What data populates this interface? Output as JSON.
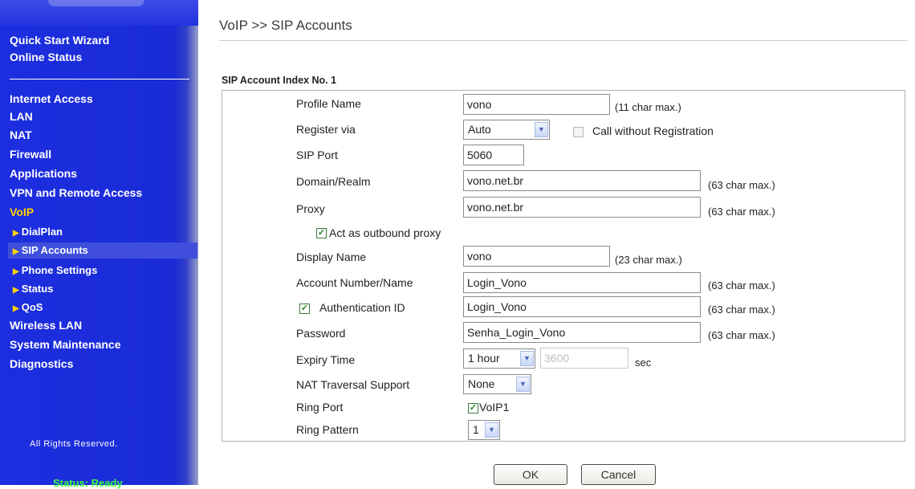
{
  "sidebar": {
    "top_items": [
      "Quick Start Wizard",
      "Online Status"
    ],
    "items": [
      "Internet Access",
      "LAN",
      "NAT",
      "Firewall",
      "Applications",
      "VPN and Remote Access",
      "VoIP"
    ],
    "voip_sub": [
      "DialPlan",
      "SIP Accounts",
      "Phone Settings",
      "Status",
      "QoS"
    ],
    "bottom_items": [
      "Wireless LAN",
      "System Maintenance",
      "Diagnostics"
    ],
    "rights": "All Rights Reserved.",
    "status": "Status: Ready",
    "selected_sub": "SIP Accounts",
    "active_section": "VoIP",
    "accent_color": "#ffd200"
  },
  "main": {
    "title": "VoIP >> SIP Accounts",
    "section_title": "SIP Account Index No. 1",
    "form": {
      "profile_name": {
        "label": "Profile Name",
        "value": "vono",
        "hint": "(11 char max.)"
      },
      "register_via": {
        "label": "Register via",
        "value": "Auto",
        "checkbox_label": "Call without Registration",
        "checkbox_checked": false
      },
      "sip_port": {
        "label": "SIP Port",
        "value": "5060"
      },
      "domain": {
        "label": "Domain/Realm",
        "value": "vono.net.br",
        "hint": "(63 char max.)"
      },
      "proxy": {
        "label": "Proxy",
        "value": "vono.net.br",
        "hint": "(63 char max.)"
      },
      "outbound_proxy": {
        "label": "Act as outbound proxy",
        "checked": true
      },
      "display_name": {
        "label": "Display Name",
        "value": "vono",
        "hint": "(23 char max.)"
      },
      "account_number": {
        "label": "Account Number/Name",
        "value": "Login_Vono",
        "hint": "(63 char max.)"
      },
      "auth_id": {
        "label": "Authentication ID",
        "value": "Login_Vono",
        "hint": "(63 char max.)",
        "checked": true
      },
      "password": {
        "label": "Password",
        "value": "Senha_Login_Vono",
        "hint": "(63 char max.)"
      },
      "expiry": {
        "label": "Expiry Time",
        "value": "1 hour",
        "seconds": "3600",
        "unit": "sec"
      },
      "nat": {
        "label": "NAT Traversal Support",
        "value": "None"
      },
      "ring_port": {
        "label": "Ring Port",
        "value": "VoIP1",
        "checked": true
      },
      "ring_pattern": {
        "label": "Ring Pattern",
        "value": "1"
      }
    },
    "buttons": {
      "ok": "OK",
      "cancel": "Cancel"
    }
  }
}
